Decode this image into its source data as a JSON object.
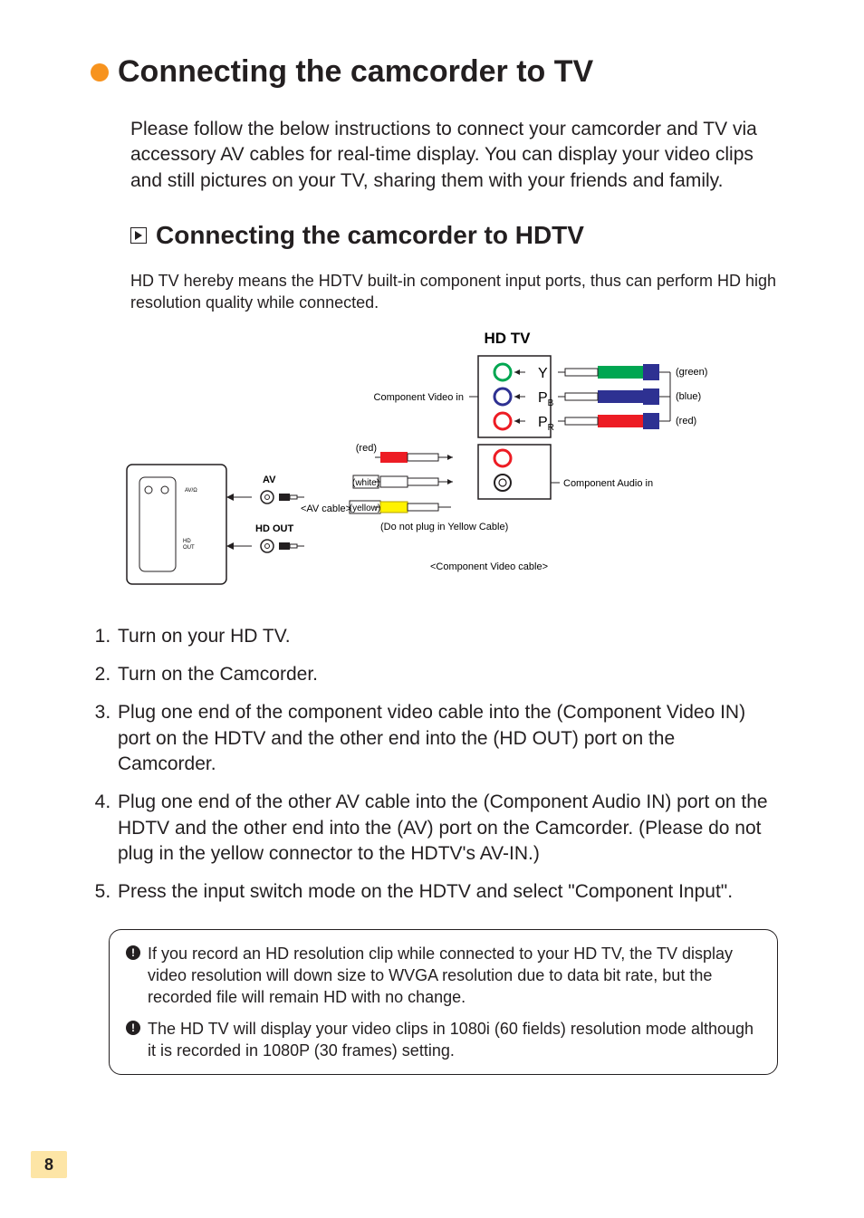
{
  "title": "Connecting the camcorder to TV",
  "intro": "Please follow the below instructions to connect your camcorder and TV via accessory AV cables for real-time display. You can display your video clips and still pictures on your TV, sharing them with your friends and family.",
  "subtitle": "Connecting the camcorder to HDTV",
  "subintro": "HD TV hereby means the HDTV built-in component input ports, thus can perform HD high resolution quality while connected.",
  "diagram": {
    "hd_tv": "HD TV",
    "component_video_in": "Component Video in",
    "component_audio_in": "Component Audio in",
    "y": "Y",
    "pb": "P",
    "pb_sub": "B",
    "pr": "P",
    "pr_sub": "R",
    "green": "(green)",
    "blue": "(blue)",
    "red": "(red)",
    "white": "(white)",
    "yellow": "(yellow)",
    "av": "AV",
    "hd_out": "HD OUT",
    "av_cable": "<AV cable>",
    "no_yellow": "(Do not plug in Yellow Cable)",
    "component_cable": "<Component Video cable>"
  },
  "steps": [
    "Turn on your HD TV.",
    "Turn on the Camcorder.",
    "Plug one end of the component video cable into the (Component Video IN) port on the HDTV and the other end into the (HD OUT) port on the Camcorder.",
    "Plug one end of the other AV cable into the (Component Audio IN) port on the HDTV and the other end into the (AV) port on the Camcorder. (Please do not plug in the yellow connector to the HDTV's AV-IN.)",
    "Press the input switch mode on the HDTV and select \"Component Input\"."
  ],
  "notes": [
    "If you record an HD resolution clip while connected to your HD TV, the TV display video resolution will down size to WVGA resolution due to data bit rate, but the recorded file will remain HD with no change.",
    "The HD TV will display your video clips in 1080i (60 fields) resolution mode although it is recorded in 1080P (30 frames) setting."
  ],
  "page_number": "8"
}
